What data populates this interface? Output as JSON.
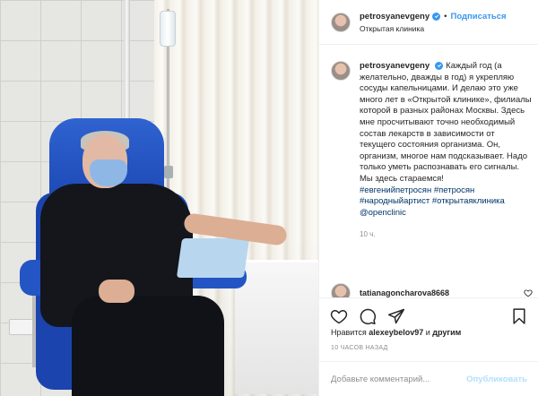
{
  "header": {
    "username": "petrosyanevgeny",
    "follow_label": "Подписаться",
    "location": "Открытая клиника"
  },
  "caption": {
    "username": "petrosyanevgeny",
    "text": "Каждый год (а желательно, дважды в год) я укрепляю сосуды капельницами. И делаю это уже много лет в «Открытой клинике», филиалы которой в разных районах Москвы. Здесь мне просчитывают точно необходимый состав лекарств в зависимости от текущего состояния организма. Он, организм, многое нам подсказывает. Надо только уметь распознавать его сигналы. Мы здесь стараемся!",
    "hashtags": "#евгенийпетросян #петросян #народныйартист #открытаяклиника @openclinic",
    "time": "10 ч."
  },
  "comment": {
    "username": "tatianagoncharova8668"
  },
  "likes": {
    "prefix": "Нравится ",
    "user": "alexeybelov97",
    "suffix": " и ",
    "others": "другим"
  },
  "timestamp": "10 ЧАСОВ НАЗАД",
  "add_comment": {
    "placeholder": "Добавьте комментарий...",
    "publish_label": "Опубликовать"
  },
  "icons": {
    "like": "heart-icon",
    "comment": "comment-icon",
    "share": "share-icon",
    "save": "bookmark-icon",
    "verified": "verified-badge-icon"
  },
  "colors": {
    "link": "#3897f0",
    "hashtag": "#003569",
    "muted": "#8e8e8e",
    "publish_disabled": "#b2dffc"
  }
}
